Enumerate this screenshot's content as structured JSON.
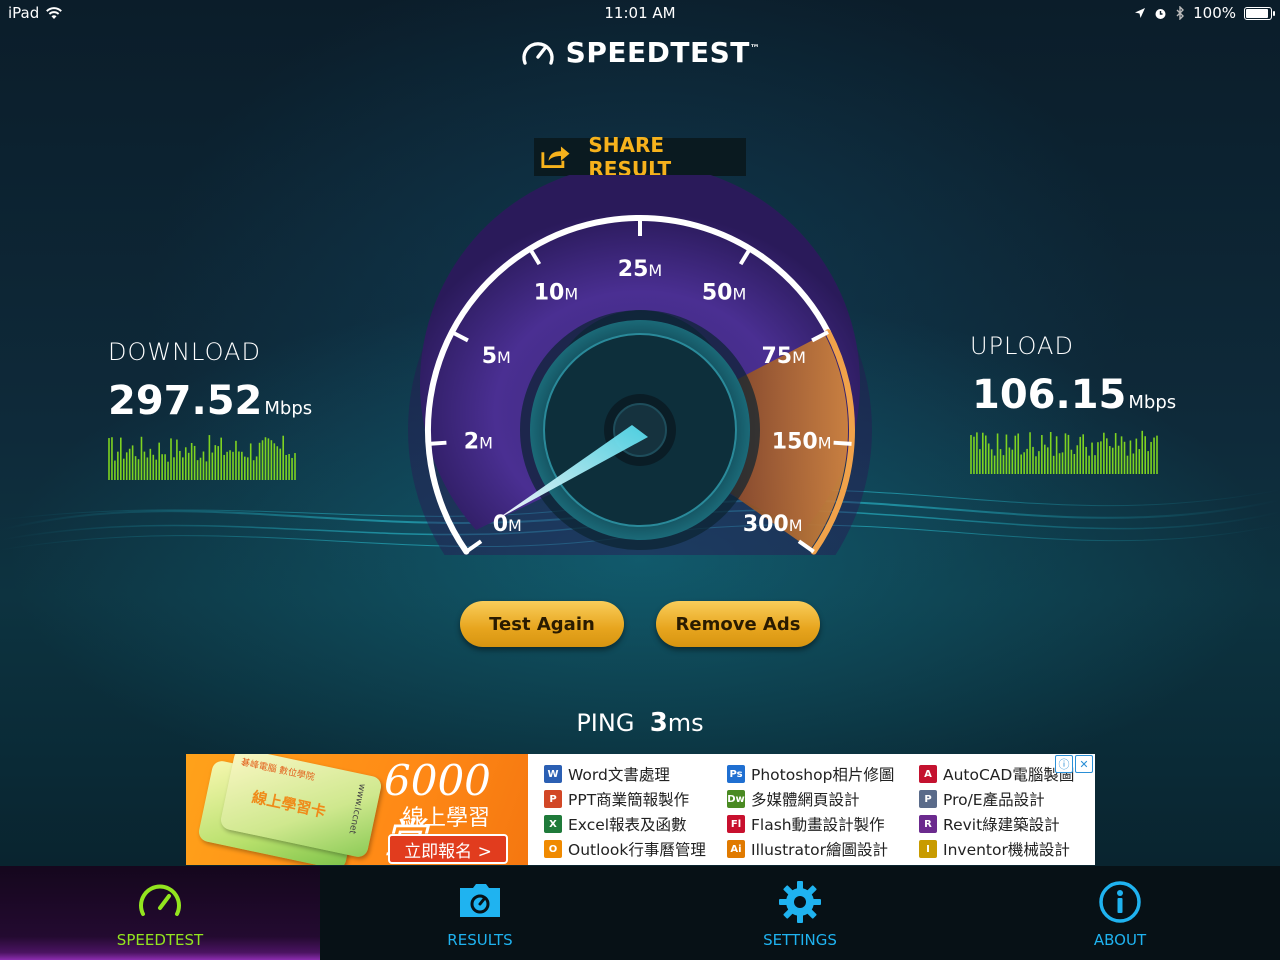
{
  "status_bar": {
    "device": "iPad",
    "time": "11:01 AM",
    "battery": "100%",
    "battery_level": 1.0
  },
  "app": {
    "logo_text": "SPEEDTEST",
    "logo_mark": "™"
  },
  "share": {
    "label": "SHARE RESULT",
    "icon": "share-icon"
  },
  "download": {
    "title": "DOWNLOAD",
    "value": "297.52",
    "unit": "Mbps",
    "color": "#7ed321"
  },
  "upload": {
    "title": "UPLOAD",
    "value": "106.15",
    "unit": "Mbps",
    "color": "#7ed321"
  },
  "gauge": {
    "labels": [
      {
        "num": "0",
        "unit": "M"
      },
      {
        "num": "2",
        "unit": "M"
      },
      {
        "num": "5",
        "unit": "M"
      },
      {
        "num": "10",
        "unit": "M"
      },
      {
        "num": "25",
        "unit": "M"
      },
      {
        "num": "50",
        "unit": "M"
      },
      {
        "num": "75",
        "unit": "M"
      },
      {
        "num": "150",
        "unit": "M"
      },
      {
        "num": "300",
        "unit": "M"
      }
    ],
    "needle_value": "0 M",
    "arc_color": "#6a3fb8",
    "accent_color": "#e08a3a"
  },
  "buttons": {
    "test_again": "Test Again",
    "remove_ads": "Remove Ads"
  },
  "ping": {
    "label": "PING",
    "value": "3",
    "unit": "ms"
  },
  "ad": {
    "big": "6000堂",
    "sub": "線上學習",
    "cta": "立即報名 >",
    "card_title": "線上學習卡",
    "card_brand": "碁峰電腦 數位學院",
    "card_url": "www.lccnet",
    "columns": [
      [
        {
          "icon": "W",
          "color": "#2b5fb3",
          "text": "Word文書處理"
        },
        {
          "icon": "P",
          "color": "#d24726",
          "text": "PPT商業簡報製作"
        },
        {
          "icon": "X",
          "color": "#1f7a3a",
          "text": "Excel報表及函數"
        },
        {
          "icon": "O",
          "color": "#f08a00",
          "text": "Outlook行事曆管理"
        }
      ],
      [
        {
          "icon": "Ps",
          "color": "#1f6fd1",
          "text": "Photoshop相片修圖"
        },
        {
          "icon": "Dw",
          "color": "#4a8a22",
          "text": "多媒體網頁設計"
        },
        {
          "icon": "Fl",
          "color": "#c8102e",
          "text": "Flash動畫設計製作"
        },
        {
          "icon": "Ai",
          "color": "#e07a00",
          "text": "Illustrator繪圖設計"
        }
      ],
      [
        {
          "icon": "A",
          "color": "#c4122f",
          "text": "AutoCAD電腦製圖"
        },
        {
          "icon": "P",
          "color": "#5a6b8a",
          "text": "Pro/E產品設計"
        },
        {
          "icon": "R",
          "color": "#6b2a8e",
          "text": "Revit綠建築設計"
        },
        {
          "icon": "I",
          "color": "#c89b00",
          "text": "Inventor機械設計"
        }
      ]
    ],
    "badge_info": "ⓘ",
    "badge_close": "✕"
  },
  "tabs": [
    {
      "label": "SPEEDTEST",
      "icon": "speedometer-icon",
      "active": true
    },
    {
      "label": "RESULTS",
      "icon": "results-folder-icon",
      "active": false
    },
    {
      "label": "SETTINGS",
      "icon": "gear-icon",
      "active": false
    },
    {
      "label": "ABOUT",
      "icon": "info-icon",
      "active": false
    }
  ]
}
